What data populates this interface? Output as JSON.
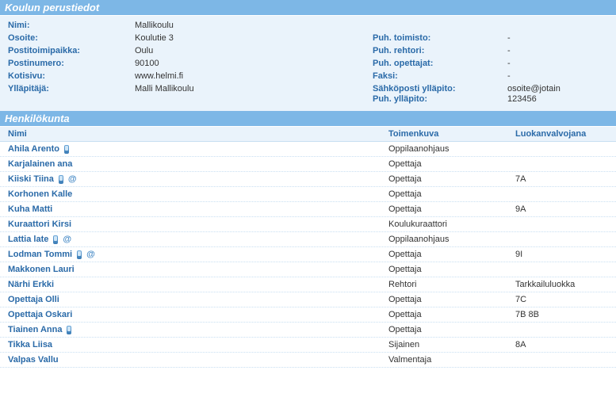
{
  "sections": {
    "basic": "Koulun perustiedot",
    "staff": "Henkilökunta"
  },
  "labels": {
    "name": "Nimi:",
    "address": "Osoite:",
    "city": "Postitoimipaikka:",
    "zip": "Postinumero:",
    "homepage": "Kotisivu:",
    "maintainer": "Ylläpitäjä:",
    "phoneOffice": "Puh. toimisto:",
    "phonePrincipal": "Puh. rehtori:",
    "phoneTeachers": "Puh. opettajat:",
    "fax": "Faksi:",
    "emailMaint": "Sähköposti ylläpito:",
    "phoneMaint": "Puh. ylläpito:"
  },
  "values": {
    "name": "Mallikoulu",
    "address": "Koulutie 3",
    "city": "Oulu",
    "zip": "90100",
    "homepage": "www.helmi.fi",
    "maintainer": "Malli Mallikoulu",
    "phoneOffice": "-",
    "phonePrincipal": "-",
    "phoneTeachers": "-",
    "fax": "-",
    "emailMaint": "osoite@jotain",
    "phoneMaint": "123456"
  },
  "staffHeaders": {
    "name": "Nimi",
    "role": "Toimenkuva",
    "class": "Luokanvalvojana"
  },
  "staff": [
    {
      "name": "Ahila Arento",
      "role": "Oppilaanohjaus",
      "class": "",
      "phone": true,
      "email": false
    },
    {
      "name": "Karjalainen ana",
      "role": "Opettaja",
      "class": "",
      "phone": false,
      "email": false
    },
    {
      "name": "Kiiski Tiina",
      "role": "Opettaja",
      "class": "7A",
      "phone": true,
      "email": true
    },
    {
      "name": "Korhonen Kalle",
      "role": "Opettaja",
      "class": "",
      "phone": false,
      "email": false
    },
    {
      "name": "Kuha Matti",
      "role": "Opettaja",
      "class": "9A",
      "phone": false,
      "email": false
    },
    {
      "name": "Kuraattori Kirsi",
      "role": "Koulukuraattori",
      "class": "",
      "phone": false,
      "email": false
    },
    {
      "name": "Lattia late",
      "role": "Oppilaanohjaus",
      "class": "",
      "phone": true,
      "email": true
    },
    {
      "name": "Lodman Tommi",
      "role": "Opettaja",
      "class": "9I",
      "phone": true,
      "email": true
    },
    {
      "name": "Makkonen Lauri",
      "role": "Opettaja",
      "class": "",
      "phone": false,
      "email": false
    },
    {
      "name": "Närhi Erkki",
      "role": "Rehtori",
      "class": "Tarkkailuluokka",
      "phone": false,
      "email": false
    },
    {
      "name": "Opettaja Olli",
      "role": "Opettaja",
      "class": "7C",
      "phone": false,
      "email": false
    },
    {
      "name": "Opettaja Oskari",
      "role": "Opettaja",
      "class": "7B   8B",
      "phone": false,
      "email": false
    },
    {
      "name": "Tiainen Anna",
      "role": "Opettaja",
      "class": "",
      "phone": true,
      "email": false
    },
    {
      "name": "Tikka Liisa",
      "role": "Sijainen",
      "class": "8A",
      "phone": false,
      "email": false
    },
    {
      "name": "Valpas Vallu",
      "role": "Valmentaja",
      "class": "",
      "phone": false,
      "email": false
    }
  ]
}
